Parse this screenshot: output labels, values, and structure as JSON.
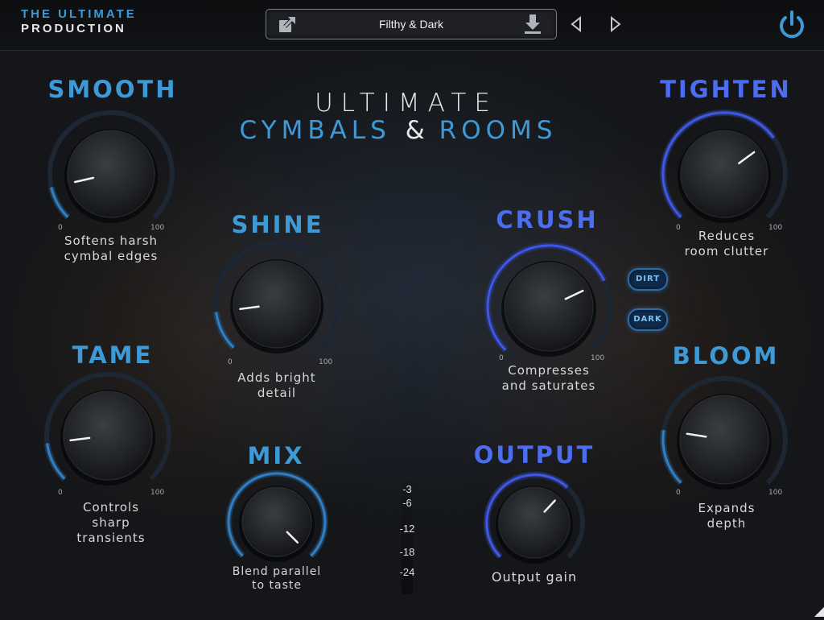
{
  "brand": {
    "line1": "THE ULTIMATE",
    "line2": "PRODUCTION"
  },
  "preset": {
    "name": "Filthy & Dark",
    "export_icon": "export-icon",
    "save_icon": "download-icon"
  },
  "nav": {
    "prev_icon": "triangle-left-icon",
    "next_icon": "triangle-right-icon"
  },
  "power_icon": "power-icon",
  "title": {
    "line1": "ULTIMATE",
    "line2_a": "CYMBALS",
    "amp": "&",
    "line2_b": "ROOMS"
  },
  "colors": {
    "blue_label": "#3d9ad6",
    "purple_label": "#4d6df0",
    "ring_blue": "#2f7fc2",
    "ring_purple": "#3f57e8"
  },
  "knobs": {
    "smooth": {
      "label": "SMOOTH",
      "desc1": "Softens harsh",
      "desc2": "cymbal edges",
      "min": "0",
      "max": "100",
      "value": 12
    },
    "tame": {
      "label": "TAME",
      "desc1": "Controls",
      "desc2": "sharp",
      "desc3": "transients",
      "min": "0",
      "max": "100",
      "value": 14
    },
    "shine": {
      "label": "SHINE",
      "desc1": "Adds bright",
      "desc2": "detail",
      "min": "0",
      "max": "100",
      "value": 14
    },
    "mix": {
      "label": "MIX",
      "desc1": "Blend parallel",
      "desc2": "to taste",
      "value": 100
    },
    "crush": {
      "label": "CRUSH",
      "desc1": "Compresses",
      "desc2": "and saturates",
      "min": "0",
      "max": "100",
      "value": 74
    },
    "output": {
      "label": "OUTPUT",
      "desc1": "Output gain",
      "value": 66
    },
    "tighten": {
      "label": "TIGHTEN",
      "desc1": "Reduces",
      "desc2": "room clutter",
      "min": "0",
      "max": "100",
      "value": 70
    },
    "bloom": {
      "label": "BLOOM",
      "desc1": "Expands",
      "desc2": "depth",
      "min": "0",
      "max": "100",
      "value": 20
    }
  },
  "buttons": {
    "dirt": "DIRT",
    "dark": "DARK"
  },
  "meter": {
    "labels": [
      "-3",
      "-6",
      "-12",
      "-18",
      "-24"
    ]
  }
}
